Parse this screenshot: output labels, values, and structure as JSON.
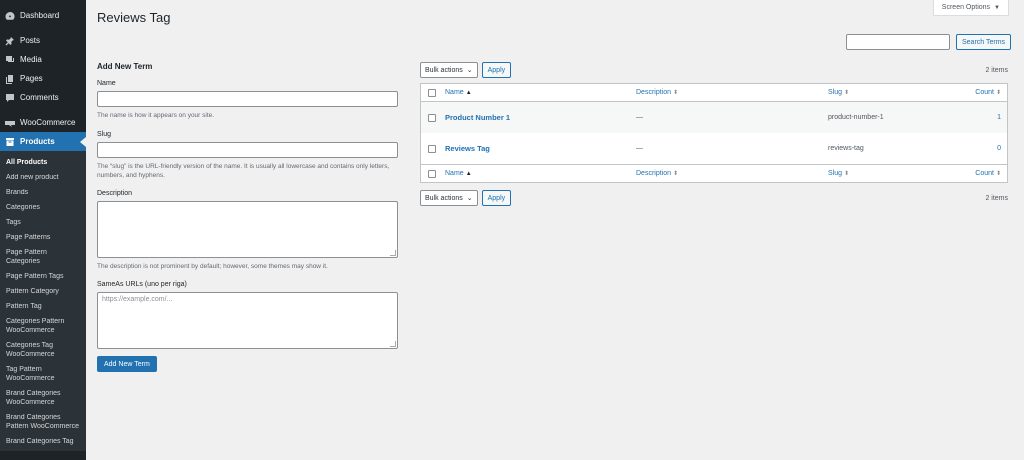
{
  "sidebar": {
    "top_items": [
      {
        "label": "Dashboard",
        "icon": "dashboard-icon"
      },
      {
        "label": "Posts",
        "icon": "pin-icon"
      },
      {
        "label": "Media",
        "icon": "media-icon"
      },
      {
        "label": "Pages",
        "icon": "pages-icon"
      },
      {
        "label": "Comments",
        "icon": "comment-icon"
      },
      {
        "label": "WooCommerce",
        "icon": "woocommerce-icon"
      },
      {
        "label": "Products",
        "icon": "archive-icon"
      }
    ],
    "submenu": [
      "All Products",
      "Add new product",
      "Brands",
      "Categories",
      "Tags",
      "Page Patterns",
      "Page Pattern Categories",
      "Page Pattern Tags",
      "Pattern Category",
      "Pattern Tag",
      "Categories Pattern WooCommerce",
      "Categories Tag WooCommerce",
      "Tag Pattern WooCommerce",
      "Brand Categories WooCommerce",
      "Brand Categories Pattern WooCommerce",
      "Brand Categories Tag"
    ]
  },
  "header": {
    "title": "Reviews Tag",
    "screen_options": "Screen Options",
    "search_button": "Search Terms"
  },
  "form": {
    "heading": "Add New Term",
    "name_label": "Name",
    "name_hint": "The name is how it appears on your site.",
    "slug_label": "Slug",
    "slug_hint": "The “slug” is the URL-friendly version of the name. It is usually all lowercase and contains only letters, numbers, and hyphens.",
    "description_label": "Description",
    "description_hint": "The description is not prominent by default; however, some themes may show it.",
    "sameas_label": "SameAs URLs (uno per riga)",
    "sameas_placeholder": "https://example.com/...",
    "submit": "Add New Term"
  },
  "tablenav": {
    "bulk_actions": "Bulk actions",
    "apply": "Apply",
    "items_count": "2 items"
  },
  "table": {
    "columns": {
      "name": "Name",
      "description": "Description",
      "slug": "Slug",
      "count": "Count"
    },
    "rows": [
      {
        "name": "Product Number 1",
        "description": "—",
        "slug": "product-number-1",
        "count": "1"
      },
      {
        "name": "Reviews Tag",
        "description": "—",
        "slug": "reviews-tag",
        "count": "0"
      }
    ]
  },
  "colors": {
    "accent": "#2271b1",
    "sidebar_bg": "#1d2327",
    "page_bg": "#f0f0f1"
  }
}
